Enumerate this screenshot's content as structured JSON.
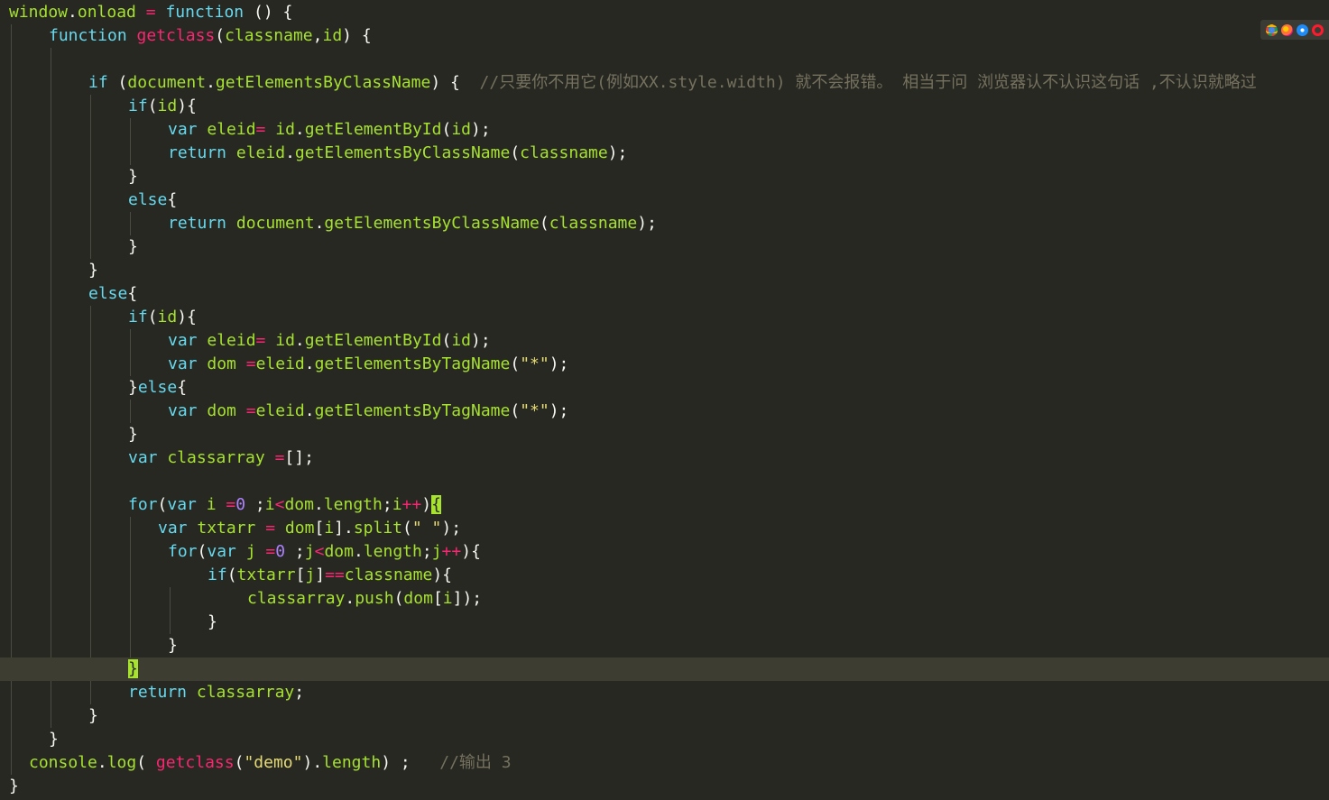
{
  "editor": {
    "theme": "monokai",
    "colors": {
      "background": "#272822",
      "current_line": "#3e3d32",
      "keyword": "#66d9ef",
      "string": "#e6db74",
      "number": "#ae81ff",
      "operator": "#f92672",
      "identifier": "#a6e22e",
      "comment": "#75715e",
      "text": "#f8f8f2"
    },
    "current_line_index": 28,
    "lines": [
      {
        "tokens": [
          [
            "id",
            "window"
          ],
          [
            "pl",
            "."
          ],
          [
            "id",
            "onload"
          ],
          [
            "pl",
            " "
          ],
          [
            "op",
            "="
          ],
          [
            "pl",
            " "
          ],
          [
            "kw",
            "function"
          ],
          [
            "pl",
            " () {"
          ]
        ]
      },
      {
        "tokens": [
          [
            "kw",
            "function"
          ],
          [
            "pl",
            " "
          ],
          [
            "fn",
            "getclass"
          ],
          [
            "pl",
            "("
          ],
          [
            "id",
            "classname"
          ],
          [
            "pl",
            ","
          ],
          [
            "id",
            "id"
          ],
          [
            "pl",
            ") {"
          ]
        ]
      },
      {
        "tokens": []
      },
      {
        "tokens": [
          [
            "kw",
            "if"
          ],
          [
            "pl",
            " ("
          ],
          [
            "id",
            "document"
          ],
          [
            "pl",
            "."
          ],
          [
            "id",
            "getElementsByClassName"
          ],
          [
            "pl",
            ") {  "
          ],
          [
            "cm",
            "//只要你不用它(例如XX.style.width) 就不会报错。 相当于问 浏览器认不认识这句话 ,不认识就略过"
          ]
        ]
      },
      {
        "tokens": [
          [
            "kw",
            "if"
          ],
          [
            "pl",
            "("
          ],
          [
            "id",
            "id"
          ],
          [
            "pl",
            "){"
          ]
        ]
      },
      {
        "tokens": [
          [
            "kw",
            "var"
          ],
          [
            "pl",
            " "
          ],
          [
            "id",
            "eleid"
          ],
          [
            "op",
            "="
          ],
          [
            "pl",
            " "
          ],
          [
            "id",
            "id"
          ],
          [
            "pl",
            "."
          ],
          [
            "id",
            "getElementById"
          ],
          [
            "pl",
            "("
          ],
          [
            "id",
            "id"
          ],
          [
            "pl",
            ");"
          ]
        ]
      },
      {
        "tokens": [
          [
            "kw",
            "return"
          ],
          [
            "pl",
            " "
          ],
          [
            "id",
            "eleid"
          ],
          [
            "pl",
            "."
          ],
          [
            "id",
            "getElementsByClassName"
          ],
          [
            "pl",
            "("
          ],
          [
            "id",
            "classname"
          ],
          [
            "pl",
            ");"
          ]
        ]
      },
      {
        "tokens": [
          [
            "pl",
            "}"
          ]
        ]
      },
      {
        "tokens": [
          [
            "kw",
            "else"
          ],
          [
            "pl",
            "{"
          ]
        ]
      },
      {
        "tokens": [
          [
            "kw",
            "return"
          ],
          [
            "pl",
            " "
          ],
          [
            "id",
            "document"
          ],
          [
            "pl",
            "."
          ],
          [
            "id",
            "getElementsByClassName"
          ],
          [
            "pl",
            "("
          ],
          [
            "id",
            "classname"
          ],
          [
            "pl",
            ");"
          ]
        ]
      },
      {
        "tokens": [
          [
            "pl",
            "}"
          ]
        ]
      },
      {
        "tokens": [
          [
            "pl",
            "}"
          ]
        ]
      },
      {
        "tokens": [
          [
            "kw",
            "else"
          ],
          [
            "pl",
            "{"
          ]
        ]
      },
      {
        "tokens": [
          [
            "kw",
            "if"
          ],
          [
            "pl",
            "("
          ],
          [
            "id",
            "id"
          ],
          [
            "pl",
            "){"
          ]
        ]
      },
      {
        "tokens": [
          [
            "kw",
            "var"
          ],
          [
            "pl",
            " "
          ],
          [
            "id",
            "eleid"
          ],
          [
            "op",
            "="
          ],
          [
            "pl",
            " "
          ],
          [
            "id",
            "id"
          ],
          [
            "pl",
            "."
          ],
          [
            "id",
            "getElementById"
          ],
          [
            "pl",
            "("
          ],
          [
            "id",
            "id"
          ],
          [
            "pl",
            ");"
          ]
        ]
      },
      {
        "tokens": [
          [
            "kw",
            "var"
          ],
          [
            "pl",
            " "
          ],
          [
            "id",
            "dom"
          ],
          [
            "pl",
            " "
          ],
          [
            "op",
            "="
          ],
          [
            "id",
            "eleid"
          ],
          [
            "pl",
            "."
          ],
          [
            "id",
            "getElementsByTagName"
          ],
          [
            "pl",
            "("
          ],
          [
            "str",
            "\"*\""
          ],
          [
            "pl",
            ");"
          ]
        ]
      },
      {
        "tokens": [
          [
            "pl",
            "}"
          ],
          [
            "kw",
            "else"
          ],
          [
            "pl",
            "{"
          ]
        ]
      },
      {
        "tokens": [
          [
            "kw",
            "var"
          ],
          [
            "pl",
            " "
          ],
          [
            "id",
            "dom"
          ],
          [
            "pl",
            " "
          ],
          [
            "op",
            "="
          ],
          [
            "id",
            "eleid"
          ],
          [
            "pl",
            "."
          ],
          [
            "id",
            "getElementsByTagName"
          ],
          [
            "pl",
            "("
          ],
          [
            "str",
            "\"*\""
          ],
          [
            "pl",
            ");"
          ]
        ]
      },
      {
        "tokens": [
          [
            "pl",
            "}"
          ]
        ]
      },
      {
        "tokens": [
          [
            "kw",
            "var"
          ],
          [
            "pl",
            " "
          ],
          [
            "id",
            "classarray"
          ],
          [
            "pl",
            " "
          ],
          [
            "op",
            "="
          ],
          [
            "pl",
            "[];"
          ]
        ]
      },
      {
        "tokens": []
      },
      {
        "tokens": [
          [
            "kw",
            "for"
          ],
          [
            "pl",
            "("
          ],
          [
            "kw",
            "var"
          ],
          [
            "pl",
            " "
          ],
          [
            "id",
            "i"
          ],
          [
            "pl",
            " "
          ],
          [
            "op",
            "="
          ],
          [
            "num",
            "0"
          ],
          [
            "pl",
            " ;"
          ],
          [
            "id",
            "i"
          ],
          [
            "op",
            "<"
          ],
          [
            "id",
            "dom"
          ],
          [
            "pl",
            "."
          ],
          [
            "id",
            "length"
          ],
          [
            "pl",
            ";"
          ],
          [
            "id",
            "i"
          ],
          [
            "op",
            "++"
          ],
          [
            "pl",
            ")"
          ],
          [
            "brhl",
            "{"
          ]
        ]
      },
      {
        "tokens": [
          [
            "kw",
            "var"
          ],
          [
            "pl",
            " "
          ],
          [
            "id",
            "txtarr"
          ],
          [
            "pl",
            " "
          ],
          [
            "op",
            "="
          ],
          [
            "pl",
            " "
          ],
          [
            "id",
            "dom"
          ],
          [
            "pl",
            "["
          ],
          [
            "id",
            "i"
          ],
          [
            "pl",
            "]."
          ],
          [
            "id",
            "split"
          ],
          [
            "pl",
            "("
          ],
          [
            "str",
            "\" \""
          ],
          [
            "pl",
            ");"
          ]
        ]
      },
      {
        "tokens": [
          [
            "kw",
            "for"
          ],
          [
            "pl",
            "("
          ],
          [
            "kw",
            "var"
          ],
          [
            "pl",
            " "
          ],
          [
            "id",
            "j"
          ],
          [
            "pl",
            " "
          ],
          [
            "op",
            "="
          ],
          [
            "num",
            "0"
          ],
          [
            "pl",
            " ;"
          ],
          [
            "id",
            "j"
          ],
          [
            "op",
            "<"
          ],
          [
            "id",
            "dom"
          ],
          [
            "pl",
            "."
          ],
          [
            "id",
            "length"
          ],
          [
            "pl",
            ";"
          ],
          [
            "id",
            "j"
          ],
          [
            "op",
            "++"
          ],
          [
            "pl",
            "){"
          ]
        ]
      },
      {
        "tokens": [
          [
            "kw",
            "if"
          ],
          [
            "pl",
            "("
          ],
          [
            "id",
            "txtarr"
          ],
          [
            "pl",
            "["
          ],
          [
            "id",
            "j"
          ],
          [
            "pl",
            "]"
          ],
          [
            "op",
            "=="
          ],
          [
            "id",
            "classname"
          ],
          [
            "pl",
            "){"
          ]
        ]
      },
      {
        "tokens": [
          [
            "id",
            "classarray"
          ],
          [
            "pl",
            "."
          ],
          [
            "id",
            "push"
          ],
          [
            "pl",
            "("
          ],
          [
            "id",
            "dom"
          ],
          [
            "pl",
            "["
          ],
          [
            "id",
            "i"
          ],
          [
            "pl",
            "]);"
          ]
        ]
      },
      {
        "tokens": [
          [
            "pl",
            "}"
          ]
        ]
      },
      {
        "tokens": [
          [
            "pl",
            "}"
          ]
        ]
      },
      {
        "tokens": [
          [
            "brhl",
            "}"
          ]
        ]
      },
      {
        "tokens": [
          [
            "kw",
            "return"
          ],
          [
            "pl",
            " "
          ],
          [
            "id",
            "classarray"
          ],
          [
            "pl",
            ";"
          ]
        ]
      },
      {
        "tokens": [
          [
            "pl",
            "}"
          ]
        ]
      },
      {
        "tokens": [
          [
            "pl",
            "}"
          ]
        ]
      },
      {
        "tokens": [
          [
            "id",
            "console"
          ],
          [
            "pl",
            "."
          ],
          [
            "id",
            "log"
          ],
          [
            "pl",
            "( "
          ],
          [
            "fn",
            "getclass"
          ],
          [
            "pl",
            "("
          ],
          [
            "str",
            "\"demo\""
          ],
          [
            "pl",
            ")."
          ],
          [
            "id",
            "length"
          ],
          [
            "pl",
            ") ;   "
          ],
          [
            "cm",
            "//输出 3"
          ]
        ]
      },
      {
        "tokens": [
          [
            "pl",
            "}"
          ]
        ]
      }
    ]
  },
  "browser_preview": {
    "icons": [
      "chrome-icon",
      "firefox-icon",
      "safari-icon",
      "opera-icon"
    ]
  }
}
